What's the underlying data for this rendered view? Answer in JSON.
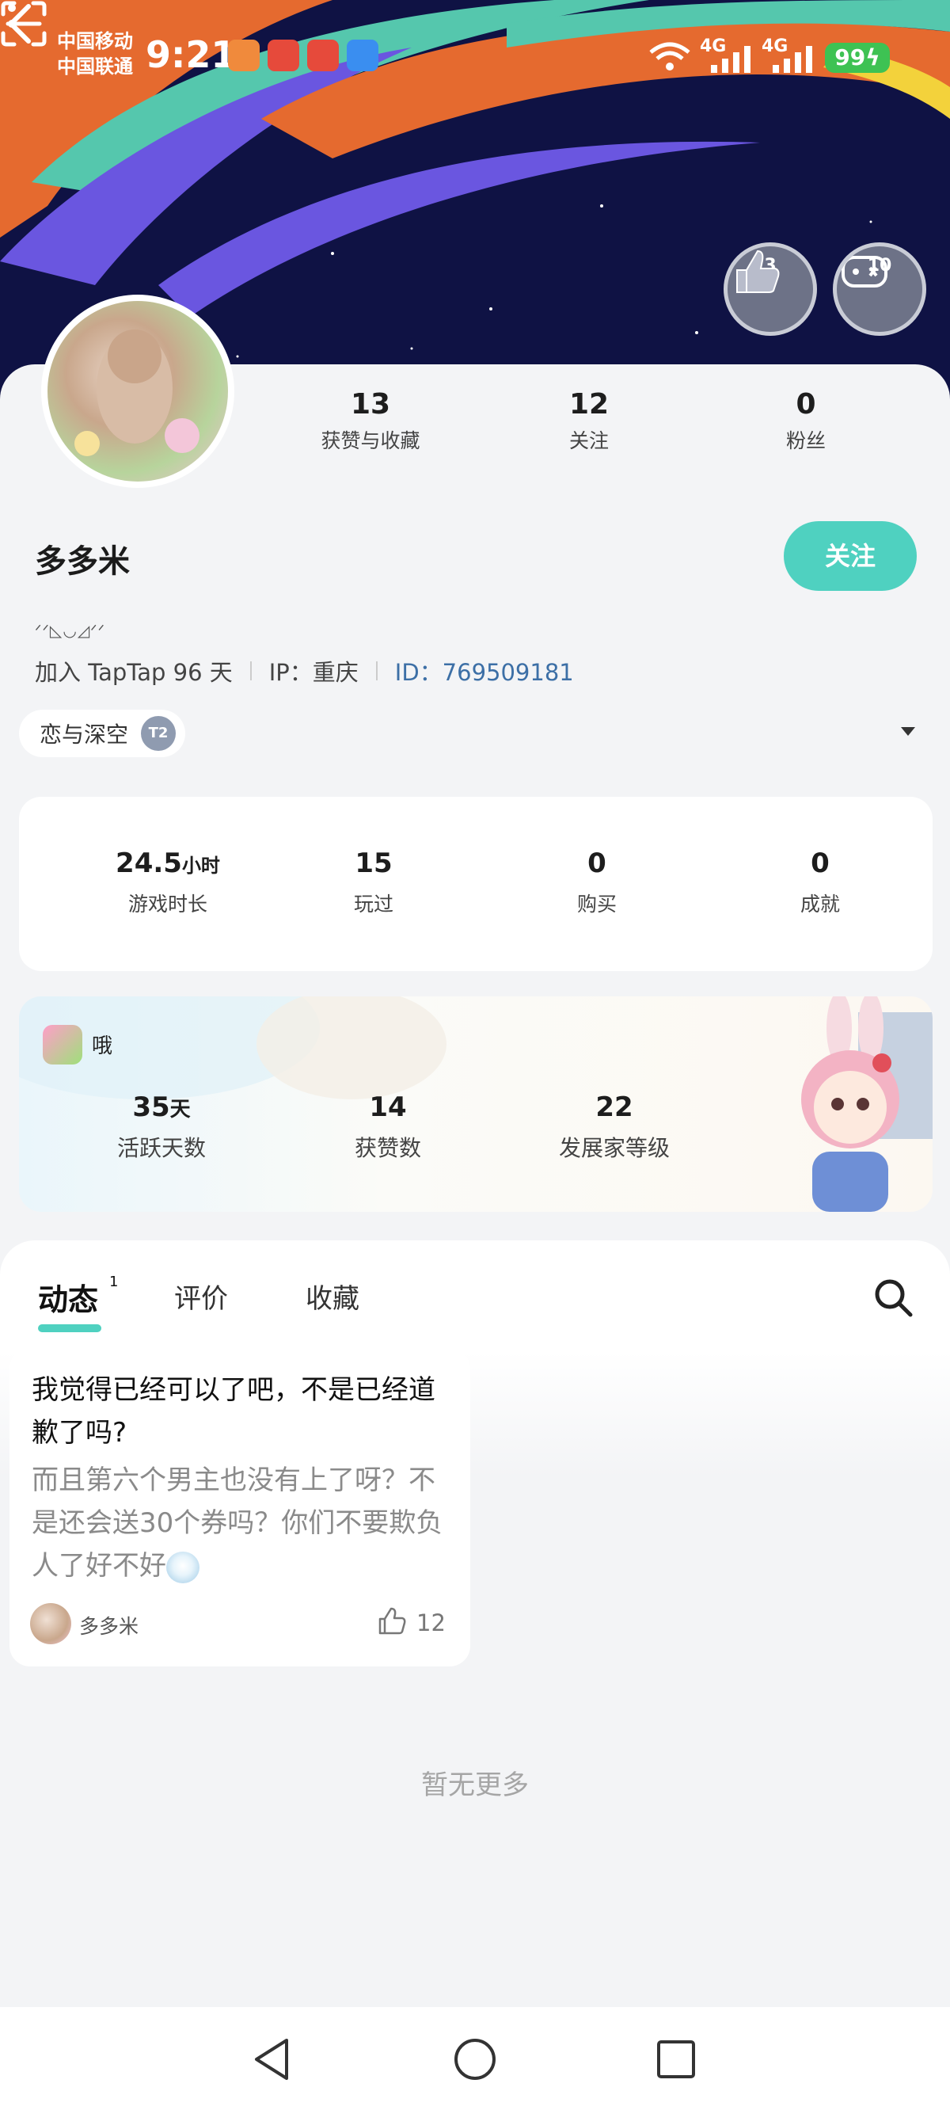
{
  "status_bar": {
    "carrier_1": "中国移动",
    "carrier_2": "中国联通",
    "time": "9:21",
    "network_1": "4G",
    "network_2": "4G",
    "battery": "99"
  },
  "header": {
    "badges": [
      {
        "count": "3"
      },
      {
        "count": "10"
      }
    ]
  },
  "profile": {
    "stats": [
      {
        "value": "13",
        "label": "获赞与收藏"
      },
      {
        "value": "12",
        "label": "关注"
      },
      {
        "value": "0",
        "label": "粉丝"
      }
    ],
    "name": "多多米",
    "follow_label": "关注",
    "bio": "ᐟᐟ◺◡◿ᐟᐟ",
    "joined": "加入 TapTap 96 天",
    "ip": "IP：重庆",
    "id": "ID：769509181",
    "game_chip": "恋与深空",
    "chip_badge": "T2"
  },
  "game_stats": [
    {
      "value": "24.5",
      "unit": "小时",
      "label": "游戏时长"
    },
    {
      "value": "15",
      "unit": "",
      "label": "玩过"
    },
    {
      "value": "0",
      "unit": "",
      "label": "购买"
    },
    {
      "value": "0",
      "unit": "",
      "label": "成就"
    }
  ],
  "developer_card": {
    "name": "哦",
    "stats": [
      {
        "value": "35",
        "unit": "天",
        "label": "活跃天数"
      },
      {
        "value": "14",
        "unit": "",
        "label": "获赞数"
      },
      {
        "value": "22",
        "unit": "",
        "label": "发展家等级"
      }
    ]
  },
  "feed": {
    "tabs": [
      {
        "label": "动态",
        "count": "1"
      },
      {
        "label": "评价"
      },
      {
        "label": "收藏"
      }
    ],
    "posts": [
      {
        "title": "我觉得已经可以了吧，不是已经道歉了吗?",
        "body": "而且第六个男主也没有上了呀？不是还会送30个券吗？你们不要欺负人了好不好",
        "author": "多多米",
        "likes": "12"
      }
    ],
    "no_more": "暂无更多"
  },
  "colors": {
    "accent": "#4fd1c0",
    "banner_bg": "#0f1244",
    "id_link": "#3c6fa6"
  }
}
